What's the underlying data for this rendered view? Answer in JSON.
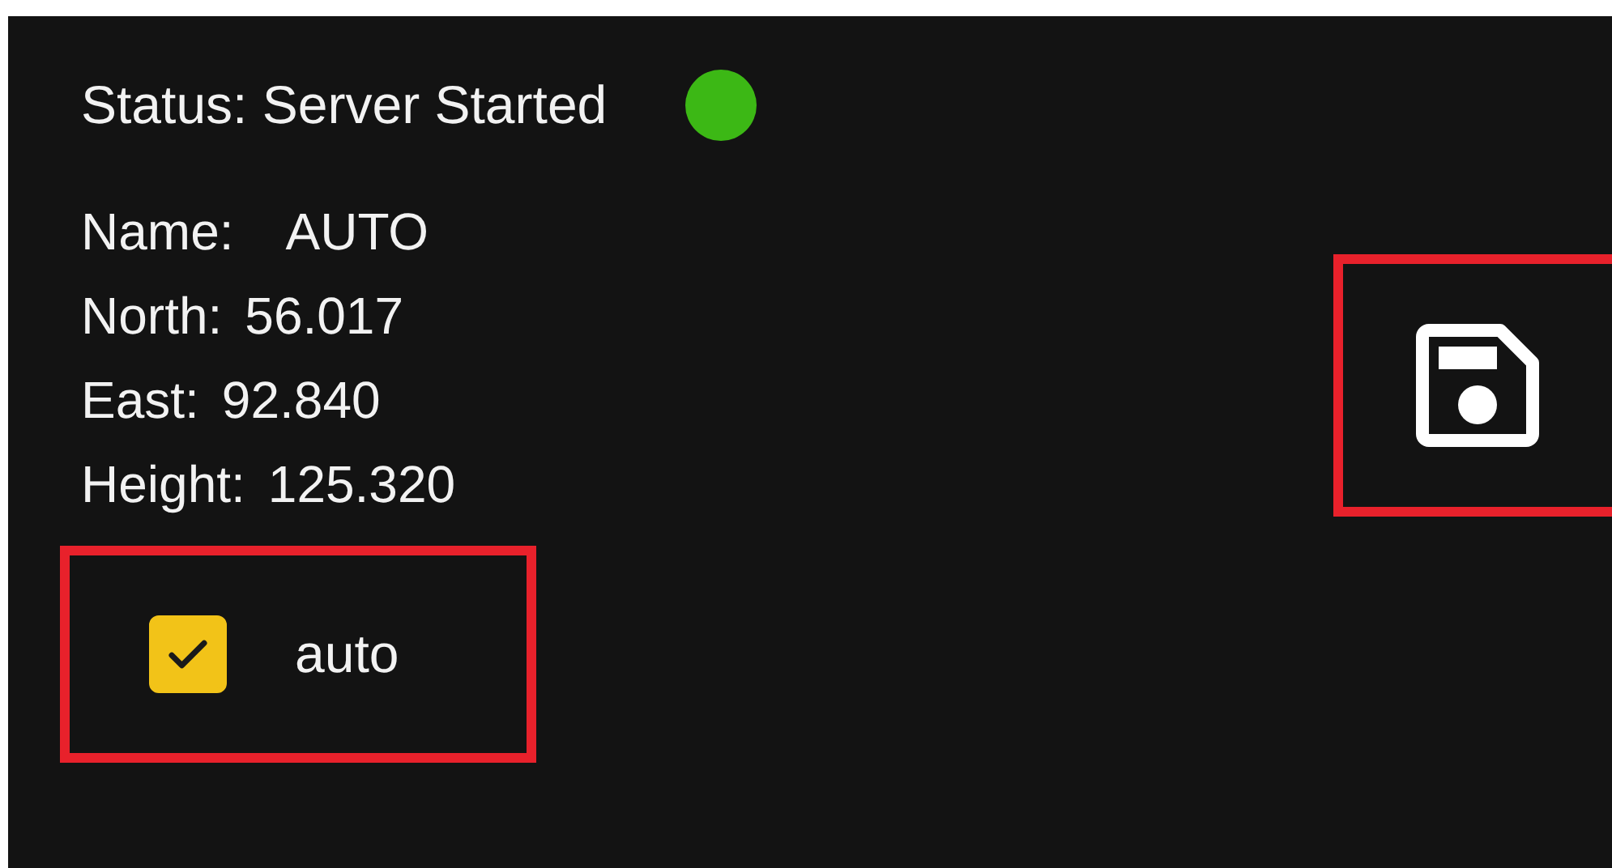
{
  "status": {
    "label": "Status: Server Started",
    "color": "#3cb815"
  },
  "fields": [
    {
      "label": "Name:",
      "value": "AUTO"
    },
    {
      "label": "North:",
      "value": "56.017"
    },
    {
      "label": "East:",
      "value": "92.840"
    },
    {
      "label": "Height:",
      "value": "125.320"
    }
  ],
  "auto_checkbox": {
    "label": "auto",
    "checked": true,
    "highlighted": true
  },
  "save_button": {
    "highlighted": true
  }
}
